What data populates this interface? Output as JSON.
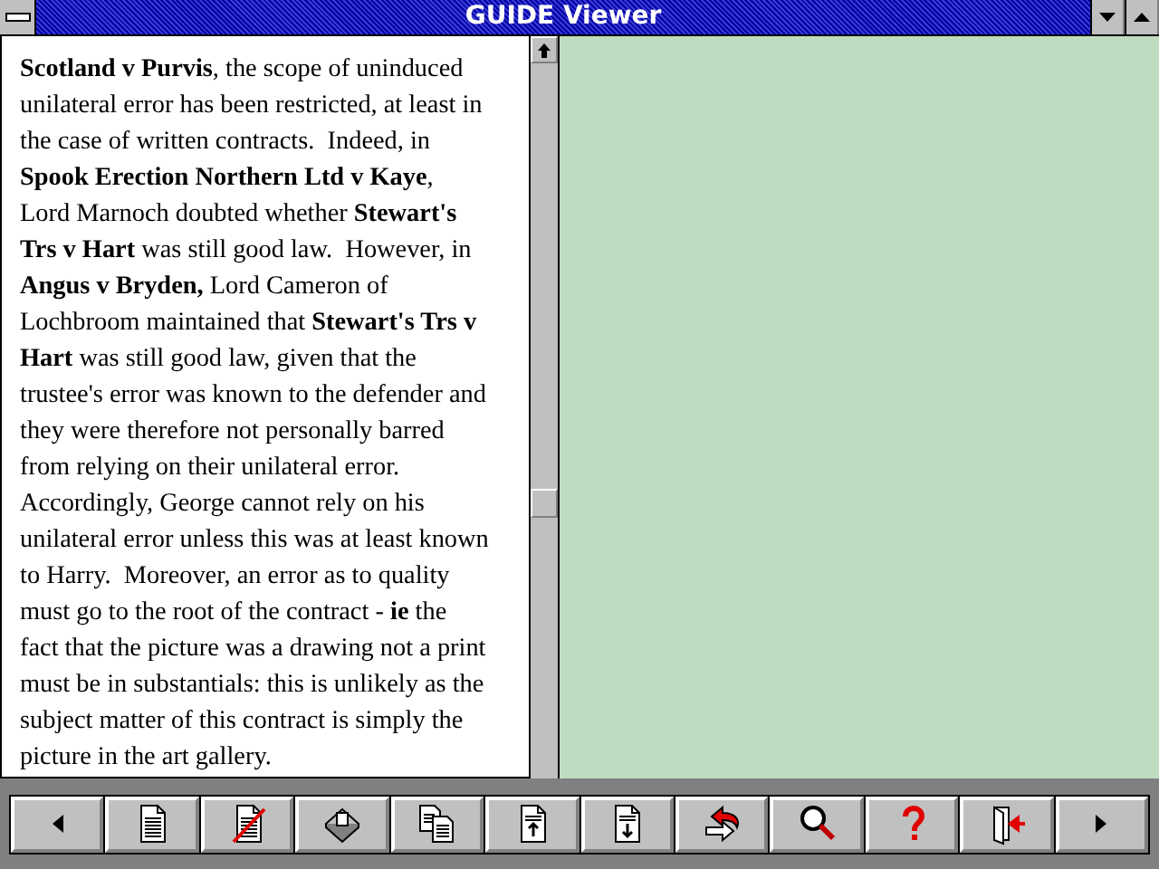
{
  "window": {
    "title": "GUIDE Viewer"
  },
  "document": {
    "lines": [
      "**Scotland v Purvis**, the scope of uninduced",
      "unilateral error has been restricted, at least in",
      "the case of written contracts.  Indeed, in",
      "**Spook Erection Northern Ltd v Kaye**,",
      "Lord Marnoch doubted whether **Stewart's**",
      "**Trs v Hart** was still good law.  However, in",
      "**Angus v Bryden,** Lord Cameron of",
      "Lochbroom maintained that **Stewart's Trs v**",
      "**Hart** was still good law, given that the",
      "trustee's error was known to the defender and",
      "they were therefore not personally barred",
      "from relying on their unilateral error.",
      "Accordingly, George cannot rely on his",
      "unilateral error unless this was at least known",
      "to Harry.  Moreover, an error as to quality",
      "must go to the root of the contract - **ie** the",
      "fact that the picture was a drawing not a print",
      "must be in substantials: this is unlikely as the",
      "subject matter of this contract is simply the",
      "picture in the art gallery."
    ]
  },
  "toolbar": {
    "buttons": [
      {
        "kind": "previous"
      },
      {
        "kind": "page"
      },
      {
        "kind": "page-crossed"
      },
      {
        "kind": "stack"
      },
      {
        "kind": "pages"
      },
      {
        "kind": "page-up"
      },
      {
        "kind": "page-down"
      },
      {
        "kind": "swap"
      },
      {
        "kind": "search"
      },
      {
        "kind": "help"
      },
      {
        "kind": "exit"
      },
      {
        "kind": "next"
      }
    ]
  }
}
